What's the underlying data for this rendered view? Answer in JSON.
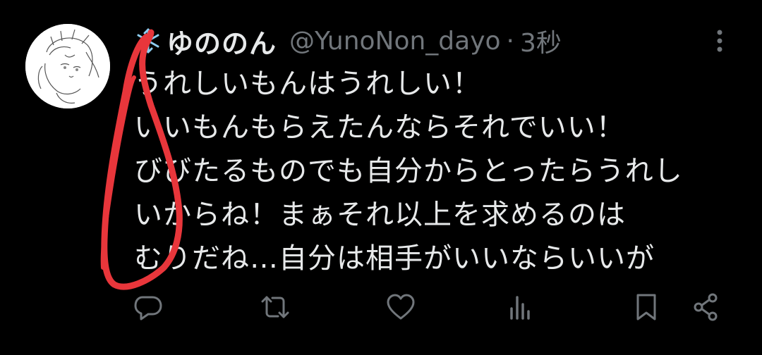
{
  "tweet": {
    "display_name": "ゆののん",
    "handle": "@YunoNon_dayo",
    "separator": "·",
    "timestamp": "3秒",
    "name_icon": "snowflake-icon",
    "text_lines": [
      "うれしいもんはうれしい！",
      "いいもんもらえたんならそれでいい！",
      "びびたるものでも自分からとったらうれし",
      "いからね！まぁそれ以上を求めるのは",
      "むりだね…自分は相手がいいならいいが"
    ]
  },
  "actions": {
    "reply_icon": "reply-icon",
    "retweet_icon": "retweet-icon",
    "like_icon": "heart-icon",
    "views_icon": "views-icon",
    "bookmark_icon": "bookmark-icon",
    "share_icon": "share-icon"
  },
  "colors": {
    "background": "#000000",
    "text": "#e7e9ea",
    "secondary": "#71767b",
    "annotation": "#e8363b",
    "snowflake": "#8ecdf0"
  }
}
